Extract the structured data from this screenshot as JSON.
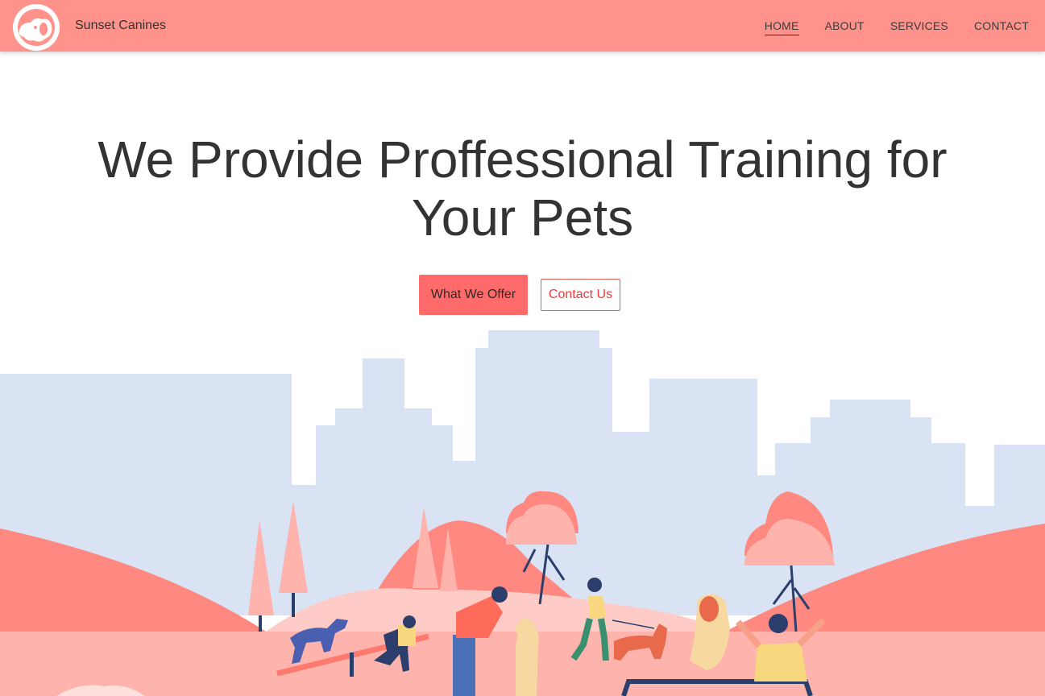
{
  "header": {
    "brand": "Sunset Canines",
    "logo_icon": "dog-logo-icon",
    "nav": [
      {
        "label": "HOME",
        "active": true
      },
      {
        "label": "ABOUT",
        "active": false
      },
      {
        "label": "SERVICES",
        "active": false
      },
      {
        "label": "CONTACT",
        "active": false
      }
    ]
  },
  "hero": {
    "title": "We Provide Proffessional Training for Your Pets",
    "primary_button": "What We Offer",
    "secondary_button": "Contact Us"
  },
  "colors": {
    "navbar": "#ff938b",
    "primary_button": "#ff6b6b",
    "outline_button_text": "#ee3b3b",
    "skyline": "#d9e3f4",
    "hills": "#ff8880",
    "ground": "#ffb3ad"
  }
}
